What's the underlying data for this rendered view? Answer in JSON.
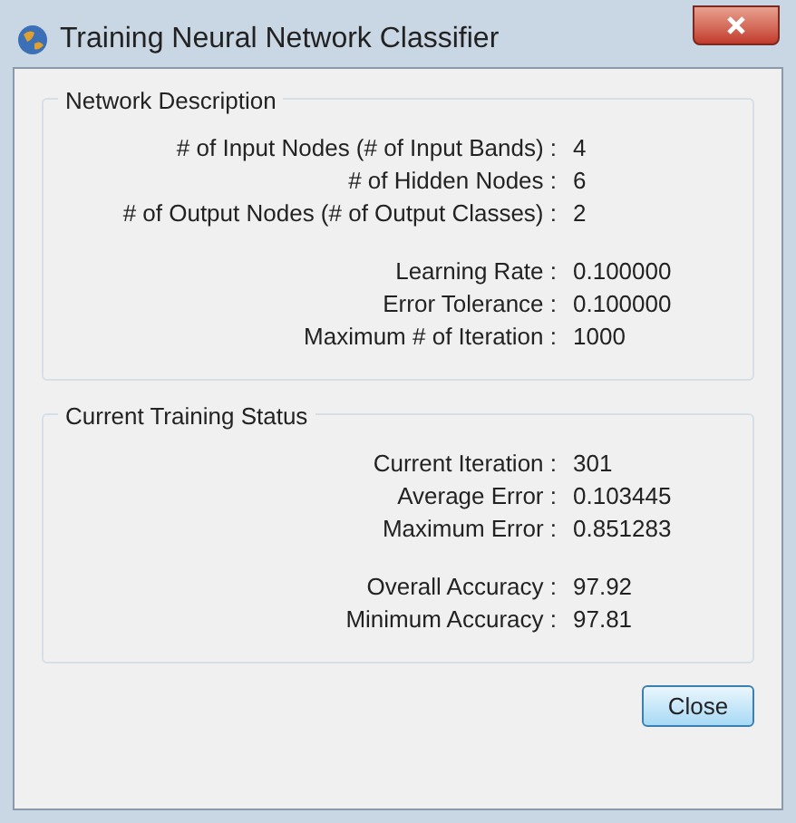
{
  "window": {
    "title": "Training Neural Network Classifier"
  },
  "sections": [
    {
      "title": "Network Description",
      "groups": [
        [
          {
            "label": "# of Input Nodes (# of Input Bands) :",
            "value": "4"
          },
          {
            "label": "# of Hidden Nodes :",
            "value": "6"
          },
          {
            "label": "# of Output Nodes (# of Output Classes) :",
            "value": "2"
          }
        ],
        [
          {
            "label": "Learning Rate :",
            "value": "0.100000"
          },
          {
            "label": "Error Tolerance :",
            "value": "0.100000"
          },
          {
            "label": "Maximum # of Iteration :",
            "value": "1000"
          }
        ]
      ]
    },
    {
      "title": "Current Training Status",
      "groups": [
        [
          {
            "label": "Current Iteration :",
            "value": "301"
          },
          {
            "label": "Average Error :",
            "value": "0.103445"
          },
          {
            "label": "Maximum Error :",
            "value": "0.851283"
          }
        ],
        [
          {
            "label": "Overall Accuracy :",
            "value": "97.92"
          },
          {
            "label": "Minimum Accuracy :",
            "value": "97.81"
          }
        ]
      ]
    }
  ],
  "buttons": [
    "Close"
  ]
}
